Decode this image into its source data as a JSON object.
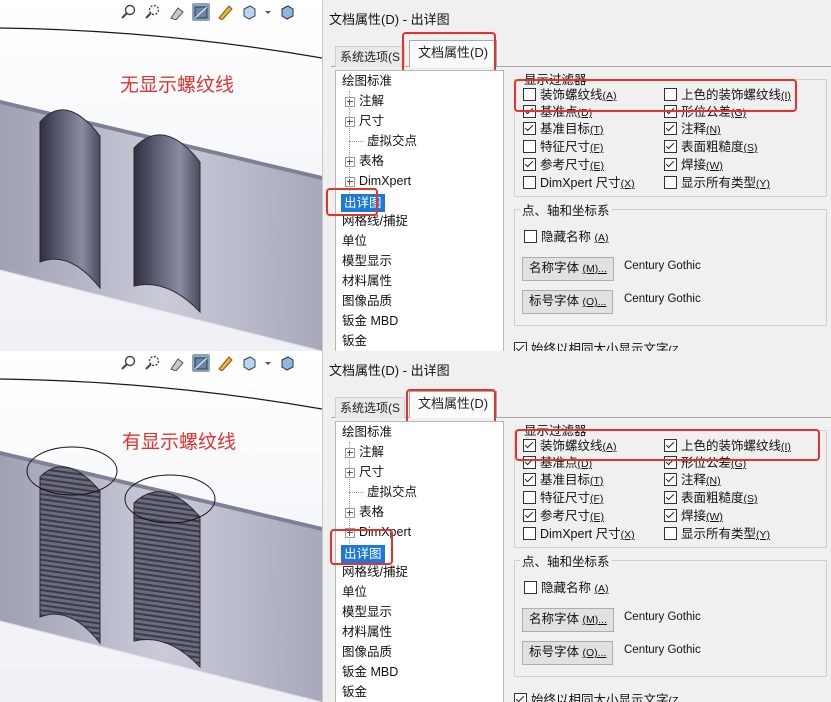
{
  "panels": [
    {
      "id": "without",
      "viewport_label": "无显示螺纹线",
      "threaded": false,
      "dialog": {
        "title": "文档属性(D) - 出详图",
        "tabs": [
          {
            "label": "系统选项(S",
            "active": false
          },
          {
            "label": "文档属性(D)",
            "active": true
          }
        ],
        "tree": [
          {
            "label": "绘图标准",
            "level": 0,
            "expander": false,
            "selected": false
          },
          {
            "label": "注解",
            "level": 1,
            "expander": true,
            "selected": false
          },
          {
            "label": "尺寸",
            "level": 1,
            "expander": true,
            "selected": false
          },
          {
            "label": "虚拟交点",
            "level": 2,
            "expander": false,
            "selected": false
          },
          {
            "label": "表格",
            "level": 1,
            "expander": true,
            "selected": false
          },
          {
            "label": "DimXpert",
            "level": 1,
            "expander": true,
            "selected": false
          },
          {
            "label": "出详图",
            "level": 0,
            "expander": false,
            "selected": true
          },
          {
            "label": "网格线/捕捉",
            "level": 0,
            "expander": false,
            "selected": false
          },
          {
            "label": "单位",
            "level": 0,
            "expander": false,
            "selected": false
          },
          {
            "label": "模型显示",
            "level": 0,
            "expander": false,
            "selected": false
          },
          {
            "label": "材料属性",
            "level": 0,
            "expander": false,
            "selected": false
          },
          {
            "label": "图像品质",
            "level": 0,
            "expander": false,
            "selected": false
          },
          {
            "label": "钣金 MBD",
            "level": 0,
            "expander": false,
            "selected": false
          },
          {
            "label": "钣金",
            "level": 0,
            "expander": false,
            "selected": false
          }
        ],
        "filter_group": {
          "title": "显示过滤器",
          "checkboxes": [
            {
              "label": "装饰螺纹线",
              "accel": "(A)",
              "checked": false
            },
            {
              "label": "上色的装饰螺纹线",
              "accel": "(I)",
              "checked": false
            },
            {
              "label": "基准点",
              "accel": "(D)",
              "checked": true
            },
            {
              "label": "形位公差",
              "accel": "(G)",
              "checked": true
            },
            {
              "label": "基准目标",
              "accel": "(T)",
              "checked": true
            },
            {
              "label": "注释",
              "accel": "(N)",
              "checked": true
            },
            {
              "label": "特征尺寸",
              "accel": "(F)",
              "checked": false
            },
            {
              "label": "表面粗糙度",
              "accel": "(S)",
              "checked": true
            },
            {
              "label": "参考尺寸",
              "accel": "(E)",
              "checked": true
            },
            {
              "label": "焊接",
              "accel": "(W)",
              "checked": true
            },
            {
              "label": "DimXpert 尺寸",
              "accel": "(X)",
              "checked": false
            },
            {
              "label": "显示所有类型",
              "accel": "(Y)",
              "checked": false
            }
          ]
        },
        "points_group": {
          "title": "点、轴和坐标系",
          "hide_names": {
            "label": "隐藏名称",
            "accel": "(A)",
            "checked": false
          },
          "name_font_btn": {
            "label": "名称字体",
            "accel": "(M)..."
          },
          "name_font_value": "Century Gothic",
          "label_font_btn": {
            "label": "标号字体",
            "accel": "(O)..."
          },
          "label_font_value": "Century Gothic"
        },
        "bottom_option": {
          "label": "始终以相同大小显示文字",
          "accel": "(Z",
          "checked": true
        }
      }
    },
    {
      "id": "with",
      "viewport_label": "有显示螺纹线",
      "threaded": true,
      "dialog": {
        "title": "文档属性(D) - 出详图",
        "tabs": [
          {
            "label": "系统选项(S",
            "active": false
          },
          {
            "label": "文档属性(D)",
            "active": true
          }
        ],
        "tree": [
          {
            "label": "绘图标准",
            "level": 0,
            "expander": false,
            "selected": false
          },
          {
            "label": "注解",
            "level": 1,
            "expander": true,
            "selected": false
          },
          {
            "label": "尺寸",
            "level": 1,
            "expander": true,
            "selected": false
          },
          {
            "label": "虚拟交点",
            "level": 2,
            "expander": false,
            "selected": false
          },
          {
            "label": "表格",
            "level": 1,
            "expander": true,
            "selected": false
          },
          {
            "label": "DimXpert",
            "level": 1,
            "expander": true,
            "selected": false
          },
          {
            "label": "出详图",
            "level": 0,
            "expander": false,
            "selected": true
          },
          {
            "label": "网格线/捕捉",
            "level": 0,
            "expander": false,
            "selected": false
          },
          {
            "label": "单位",
            "level": 0,
            "expander": false,
            "selected": false
          },
          {
            "label": "模型显示",
            "level": 0,
            "expander": false,
            "selected": false
          },
          {
            "label": "材料属性",
            "level": 0,
            "expander": false,
            "selected": false
          },
          {
            "label": "图像品质",
            "level": 0,
            "expander": false,
            "selected": false
          },
          {
            "label": "钣金 MBD",
            "level": 0,
            "expander": false,
            "selected": false
          },
          {
            "label": "钣金",
            "level": 0,
            "expander": false,
            "selected": false
          }
        ],
        "filter_group": {
          "title": "显示过滤器",
          "checkboxes": [
            {
              "label": "装饰螺纹线",
              "accel": "(A)",
              "checked": true
            },
            {
              "label": "上色的装饰螺纹线",
              "accel": "(I)",
              "checked": true
            },
            {
              "label": "基准点",
              "accel": "(D)",
              "checked": true
            },
            {
              "label": "形位公差",
              "accel": "(G)",
              "checked": true
            },
            {
              "label": "基准目标",
              "accel": "(T)",
              "checked": true
            },
            {
              "label": "注释",
              "accel": "(N)",
              "checked": true
            },
            {
              "label": "特征尺寸",
              "accel": "(F)",
              "checked": false
            },
            {
              "label": "表面粗糙度",
              "accel": "(S)",
              "checked": true
            },
            {
              "label": "参考尺寸",
              "accel": "(E)",
              "checked": true
            },
            {
              "label": "焊接",
              "accel": "(W)",
              "checked": true
            },
            {
              "label": "DimXpert 尺寸",
              "accel": "(X)",
              "checked": false
            },
            {
              "label": "显示所有类型",
              "accel": "(Y)",
              "checked": false
            }
          ]
        },
        "points_group": {
          "title": "点、轴和坐标系",
          "hide_names": {
            "label": "隐藏名称",
            "accel": "(A)",
            "checked": false
          },
          "name_font_btn": {
            "label": "名称字体",
            "accel": "(M)..."
          },
          "name_font_value": "Century Gothic",
          "label_font_btn": {
            "label": "标号字体",
            "accel": "(O)..."
          },
          "label_font_value": "Century Gothic"
        },
        "bottom_option": {
          "label": "始终以相同大小显示文字",
          "accel": "(Z",
          "checked": true
        }
      }
    }
  ],
  "toolbar_icons": [
    "zoom-to-fit-icon",
    "zoom-to-area-icon",
    "previous-view-icon",
    "section-view-icon",
    "dynamic-annotation-icon",
    "view-orientation-icon",
    "display-style-icon"
  ],
  "colors": {
    "highlight": "#e5322d",
    "selection": "#1e78d7",
    "label_red": "#e5322d"
  }
}
